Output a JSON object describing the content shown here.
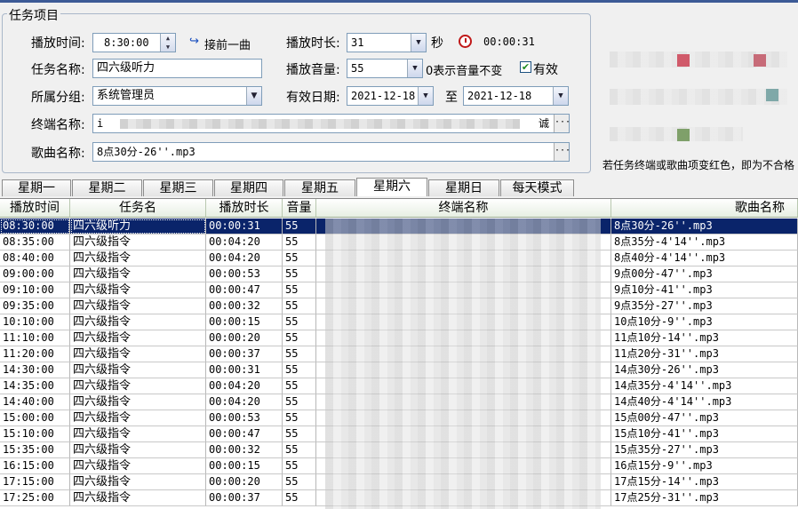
{
  "group": {
    "title": "任务项目"
  },
  "form": {
    "play_time_label": "播放时间:",
    "play_time_value": "8:30:00",
    "follow_prev_label": "接前一曲",
    "duration_label": "播放时长:",
    "duration_value": "31",
    "sec_label": "秒",
    "duration_display": "00:00:31",
    "task_name_label": "任务名称:",
    "task_name_value": "四六级听力",
    "volume_label": "播放音量:",
    "volume_value": "55",
    "volume_hint": "0表示音量不变",
    "valid_label": "有效",
    "group_label": "所属分组:",
    "group_value": "系统管理员",
    "valid_date_label": "有效日期:",
    "date_from": "2021-12-18",
    "date_to_label": "至",
    "date_to": "2021-12-18",
    "terminal_label": "终端名称:",
    "terminal_value_start": "i",
    "terminal_value_end": "诚",
    "song_label": "歌曲名称:",
    "song_value": "8点30分-26''.mp3"
  },
  "side": {
    "note": "若任务终端或歌曲项变红色，即为不合格"
  },
  "tabs": [
    "星期一",
    "星期二",
    "星期三",
    "星期四",
    "星期五",
    "星期六",
    "星期日",
    "每天模式"
  ],
  "active_tab": "星期六",
  "table": {
    "headers": [
      "播放时间",
      "任务名",
      "播放时长",
      "音量",
      "终端名称",
      "歌曲名称"
    ],
    "rows": [
      {
        "time": "08:30:00",
        "name": "四六级听力",
        "dur": "00:00:31",
        "vol": "55",
        "song": "8点30分-26''.mp3"
      },
      {
        "time": "08:35:00",
        "name": "四六级指令",
        "dur": "00:04:20",
        "vol": "55",
        "song": "8点35分-4'14''.mp3"
      },
      {
        "time": "08:40:00",
        "name": "四六级指令",
        "dur": "00:04:20",
        "vol": "55",
        "song": "8点40分-4'14''.mp3"
      },
      {
        "time": "09:00:00",
        "name": "四六级指令",
        "dur": "00:00:53",
        "vol": "55",
        "song": "9点00分-47''.mp3"
      },
      {
        "time": "09:10:00",
        "name": "四六级指令",
        "dur": "00:00:47",
        "vol": "55",
        "song": "9点10分-41''.mp3"
      },
      {
        "time": "09:35:00",
        "name": "四六级指令",
        "dur": "00:00:32",
        "vol": "55",
        "song": "9点35分-27''.mp3"
      },
      {
        "time": "10:10:00",
        "name": "四六级指令",
        "dur": "00:00:15",
        "vol": "55",
        "song": "10点10分-9''.mp3"
      },
      {
        "time": "11:10:00",
        "name": "四六级指令",
        "dur": "00:00:20",
        "vol": "55",
        "song": "11点10分-14''.mp3"
      },
      {
        "time": "11:20:00",
        "name": "四六级指令",
        "dur": "00:00:37",
        "vol": "55",
        "song": "11点20分-31''.mp3"
      },
      {
        "time": "14:30:00",
        "name": "四六级指令",
        "dur": "00:00:31",
        "vol": "55",
        "song": "14点30分-26''.mp3"
      },
      {
        "time": "14:35:00",
        "name": "四六级指令",
        "dur": "00:04:20",
        "vol": "55",
        "song": "14点35分-4'14''.mp3"
      },
      {
        "time": "14:40:00",
        "name": "四六级指令",
        "dur": "00:04:20",
        "vol": "55",
        "song": "14点40分-4'14''.mp3"
      },
      {
        "time": "15:00:00",
        "name": "四六级指令",
        "dur": "00:00:53",
        "vol": "55",
        "song": "15点00分-47''.mp3"
      },
      {
        "time": "15:10:00",
        "name": "四六级指令",
        "dur": "00:00:47",
        "vol": "55",
        "song": "15点10分-41''.mp3"
      },
      {
        "time": "15:35:00",
        "name": "四六级指令",
        "dur": "00:00:32",
        "vol": "55",
        "song": "15点35分-27''.mp3"
      },
      {
        "time": "16:15:00",
        "name": "四六级指令",
        "dur": "00:00:15",
        "vol": "55",
        "song": "16点15分-9''.mp3"
      },
      {
        "time": "17:15:00",
        "name": "四六级指令",
        "dur": "00:00:20",
        "vol": "55",
        "song": "17点15分-14''.mp3"
      },
      {
        "time": "17:25:00",
        "name": "四六级指令",
        "dur": "00:00:37",
        "vol": "55",
        "song": "17点25分-31''.mp3"
      }
    ]
  },
  "colors": {
    "selection": "#0a246a",
    "header_bg": "#e7efe3",
    "accent": "#3c5a96"
  }
}
